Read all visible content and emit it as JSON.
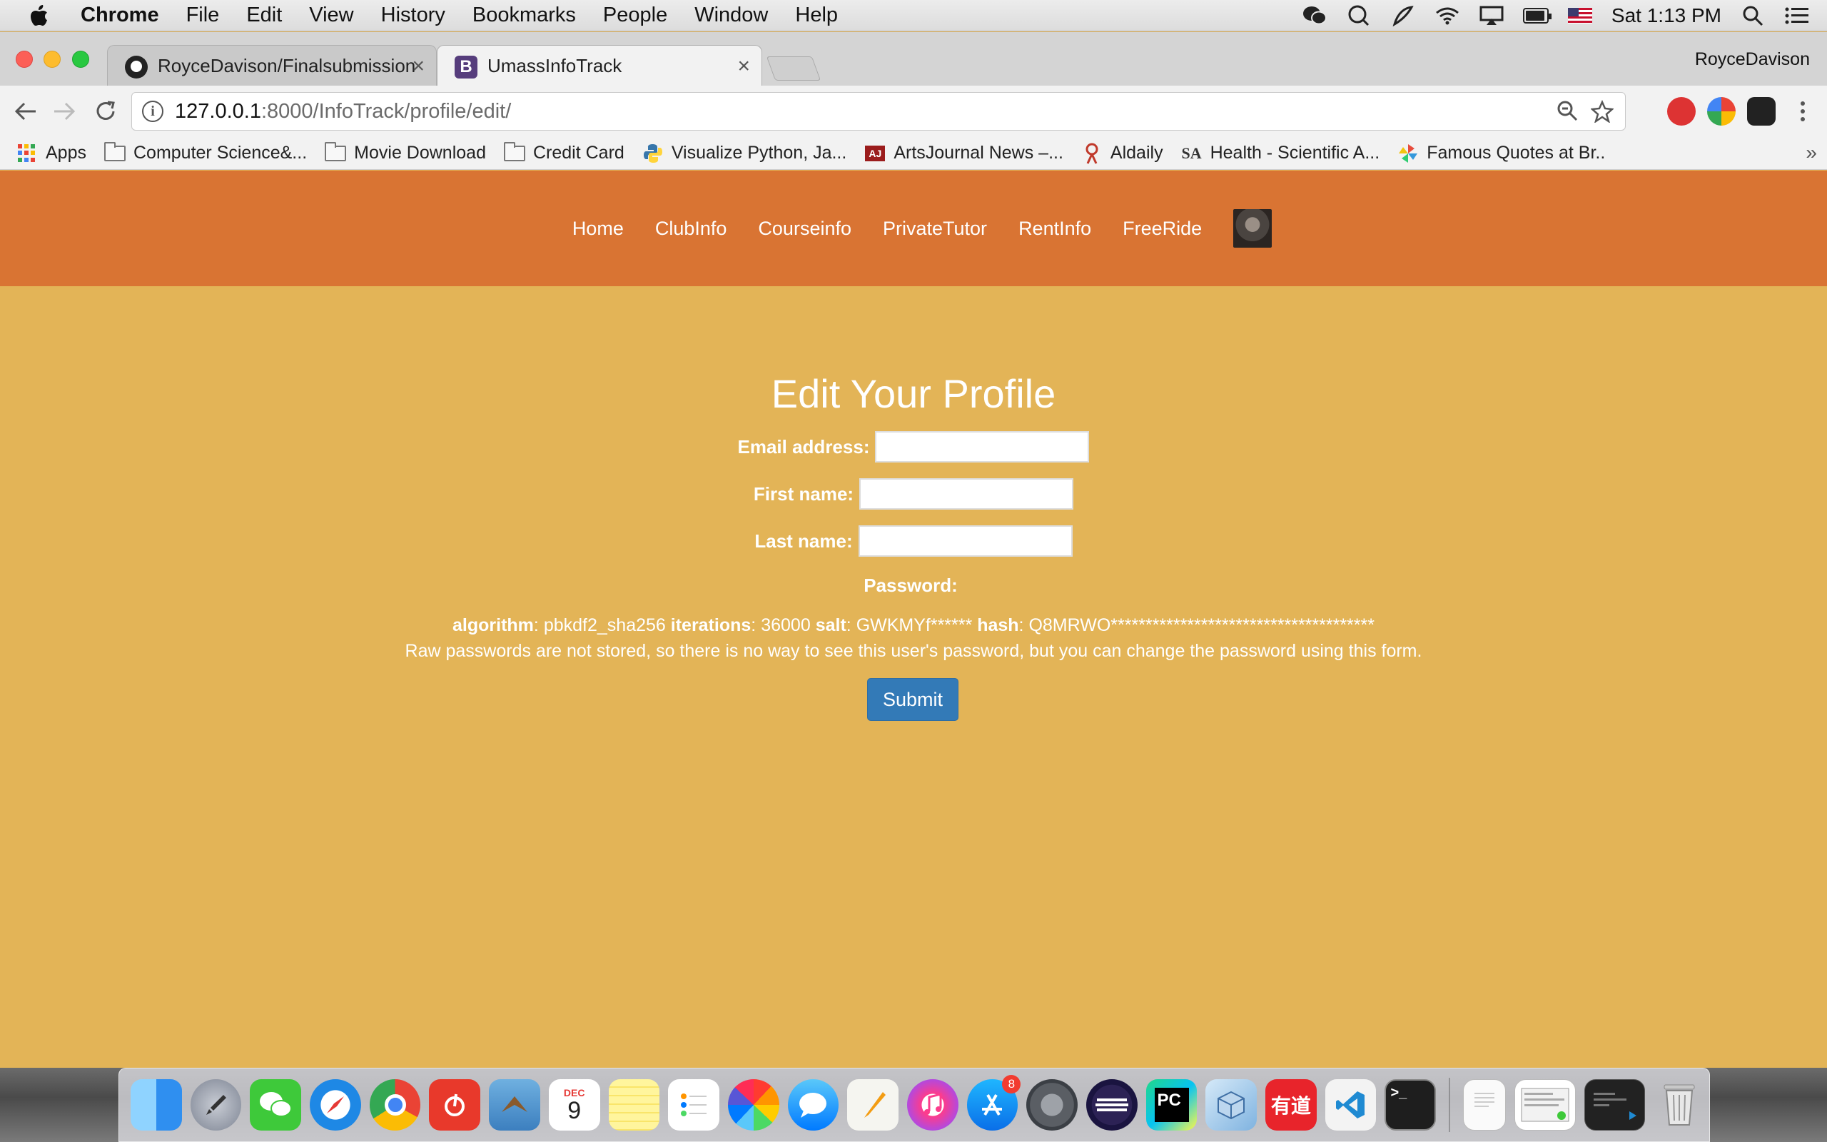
{
  "menubar": {
    "app_name": "Chrome",
    "items": [
      "File",
      "Edit",
      "View",
      "History",
      "Bookmarks",
      "People",
      "Window",
      "Help"
    ],
    "clock": "Sat 1:13 PM"
  },
  "tabs": [
    {
      "title": "RoyceDavison/Finalsubmission",
      "active": false
    },
    {
      "title": "UmassInfoTrack",
      "active": true
    }
  ],
  "tab_close_glyph": "×",
  "profile_name": "RoyceDavison",
  "address_bar": {
    "host": "127.0.0.1",
    "path": ":8000/InfoTrack/profile/edit/"
  },
  "bookmarks": [
    {
      "label": "Apps",
      "icon": "apps-grid-icon"
    },
    {
      "label": "Computer Science&...",
      "icon": "folder-icon"
    },
    {
      "label": "Movie Download",
      "icon": "folder-icon"
    },
    {
      "label": "Credit Card",
      "icon": "folder-icon"
    },
    {
      "label": "Visualize Python, Ja...",
      "icon": "python-icon"
    },
    {
      "label": "ArtsJournal News –...",
      "icon": "artsjournal-icon"
    },
    {
      "label": "Aldaily",
      "icon": "aldaily-icon"
    },
    {
      "label": "Health - Scientific A...",
      "icon": "sa-icon"
    },
    {
      "label": "Famous Quotes at Br..",
      "icon": "pinwheel-icon"
    }
  ],
  "site_nav": {
    "links": [
      "Home",
      "ClubInfo",
      "Courseinfo",
      "PrivateTutor",
      "RentInfo",
      "FreeRide"
    ]
  },
  "form": {
    "title": "Edit Your Profile",
    "email_label": "Email address:",
    "email_value": "",
    "first_name_label": "First name:",
    "first_name_value": "",
    "last_name_label": "Last name:",
    "last_name_value": "",
    "password_label": "Password:",
    "password_hash": {
      "algorithm_label": "algorithm",
      "algorithm": "pbkdf2_sha256",
      "iterations_label": "iterations",
      "iterations": "36000",
      "salt_label": "salt",
      "salt": "GWKMYf******",
      "hash_label": "hash",
      "hash": "Q8MRWO**************************************"
    },
    "password_help": "Raw passwords are not stored, so there is no way to see this user's password, but you can change the password using this form.",
    "submit_label": "Submit"
  },
  "dock": {
    "app_store_badge": "8",
    "calendar_month": "DEC",
    "calendar_day": "9",
    "pycharm_label": "PC",
    "youdao_label": "有道",
    "terminal_label": ">_"
  },
  "colors": {
    "page_bg": "#e3b457",
    "nav_bg": "#d97433",
    "submit_bg": "#337ab7"
  }
}
